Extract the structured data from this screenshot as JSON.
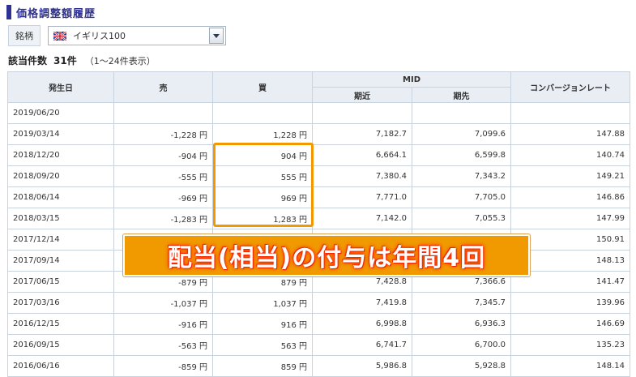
{
  "page": {
    "title": "価格調整額履歴",
    "filter_label": "銘柄",
    "selected_symbol": "イギリス100",
    "count_label": "該当件数",
    "count_value": "31件",
    "count_note": "（1～24件表示）"
  },
  "table": {
    "headers": {
      "date": "発生日",
      "sell": "売",
      "buy": "買",
      "mid": "MID",
      "mid_near": "期近",
      "mid_far": "期先",
      "conversion": "コンバージョンレート"
    },
    "rows": [
      {
        "date": "2019/06/20",
        "sell": "",
        "buy": "",
        "near": "",
        "far": "",
        "rate": ""
      },
      {
        "date": "2019/03/14",
        "sell": "-1,228 円",
        "buy": "1,228 円",
        "near": "7,182.7",
        "far": "7,099.6",
        "rate": "147.88"
      },
      {
        "date": "2018/12/20",
        "sell": "-904 円",
        "buy": "904 円",
        "near": "6,664.1",
        "far": "6,599.8",
        "rate": "140.74"
      },
      {
        "date": "2018/09/20",
        "sell": "-555 円",
        "buy": "555 円",
        "near": "7,380.4",
        "far": "7,343.2",
        "rate": "149.21"
      },
      {
        "date": "2018/06/14",
        "sell": "-969 円",
        "buy": "969 円",
        "near": "7,771.0",
        "far": "7,705.0",
        "rate": "146.86"
      },
      {
        "date": "2018/03/15",
        "sell": "-1,283 円",
        "buy": "1,283 円",
        "near": "7,142.0",
        "far": "7,055.3",
        "rate": "147.99"
      },
      {
        "date": "2017/12/14",
        "sell": "",
        "buy": "",
        "near": "",
        "far": "",
        "rate": "150.91"
      },
      {
        "date": "2017/09/14",
        "sell": "",
        "buy": "",
        "near": "",
        "far": "",
        "rate": "148.13"
      },
      {
        "date": "2017/06/15",
        "sell": "-879 円",
        "buy": "879 円",
        "near": "7,428.8",
        "far": "7,366.6",
        "rate": "141.47"
      },
      {
        "date": "2017/03/16",
        "sell": "-1,037 円",
        "buy": "1,037 円",
        "near": "7,419.8",
        "far": "7,345.7",
        "rate": "139.96"
      },
      {
        "date": "2016/12/15",
        "sell": "-916 円",
        "buy": "916 円",
        "near": "6,998.8",
        "far": "6,936.3",
        "rate": "146.69"
      },
      {
        "date": "2016/09/15",
        "sell": "-563 円",
        "buy": "563 円",
        "near": "6,741.7",
        "far": "6,700.0",
        "rate": "135.23"
      },
      {
        "date": "2016/06/16",
        "sell": "-859 円",
        "buy": "859 円",
        "near": "5,986.8",
        "far": "5,928.8",
        "rate": "148.14"
      }
    ]
  },
  "annotation": {
    "banner_text": "配当(相当)の付与は年間4回",
    "highlight_color": "#f39800"
  },
  "icons": {
    "flag": "uk-flag-icon",
    "dropdown": "chevron-down-icon"
  }
}
